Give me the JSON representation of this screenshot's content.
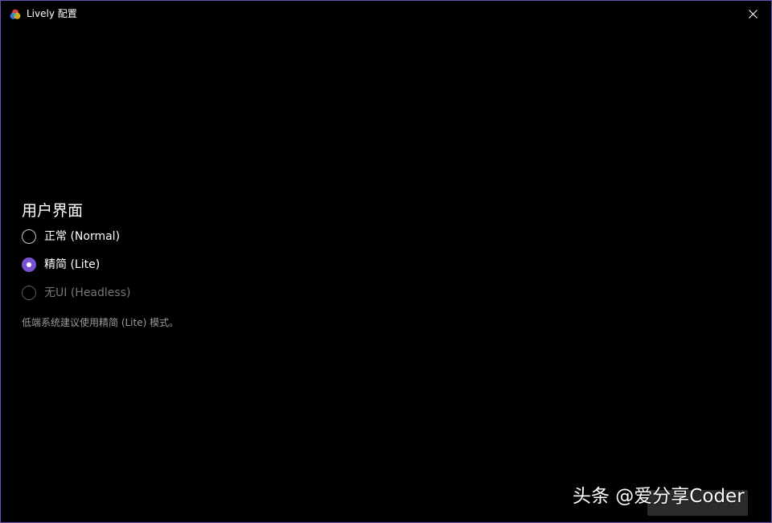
{
  "window": {
    "title": "Lively 配置",
    "accent_color": "#7a50d4",
    "border_color": "#6b4fb8"
  },
  "titlebar": {
    "app_icon": "lively-logo-icon",
    "close_icon": "close-icon"
  },
  "section": {
    "title": "用户界面",
    "options": [
      {
        "label": "正常 (Normal)",
        "selected": false,
        "enabled": true
      },
      {
        "label": "精简 (Lite)",
        "selected": true,
        "enabled": true
      },
      {
        "label": "无UI (Headless)",
        "selected": false,
        "enabled": false
      }
    ],
    "hint": "低端系统建议使用精简 (Lite) 模式。"
  },
  "watermark": {
    "text": "头条 @爱分享Coder"
  }
}
